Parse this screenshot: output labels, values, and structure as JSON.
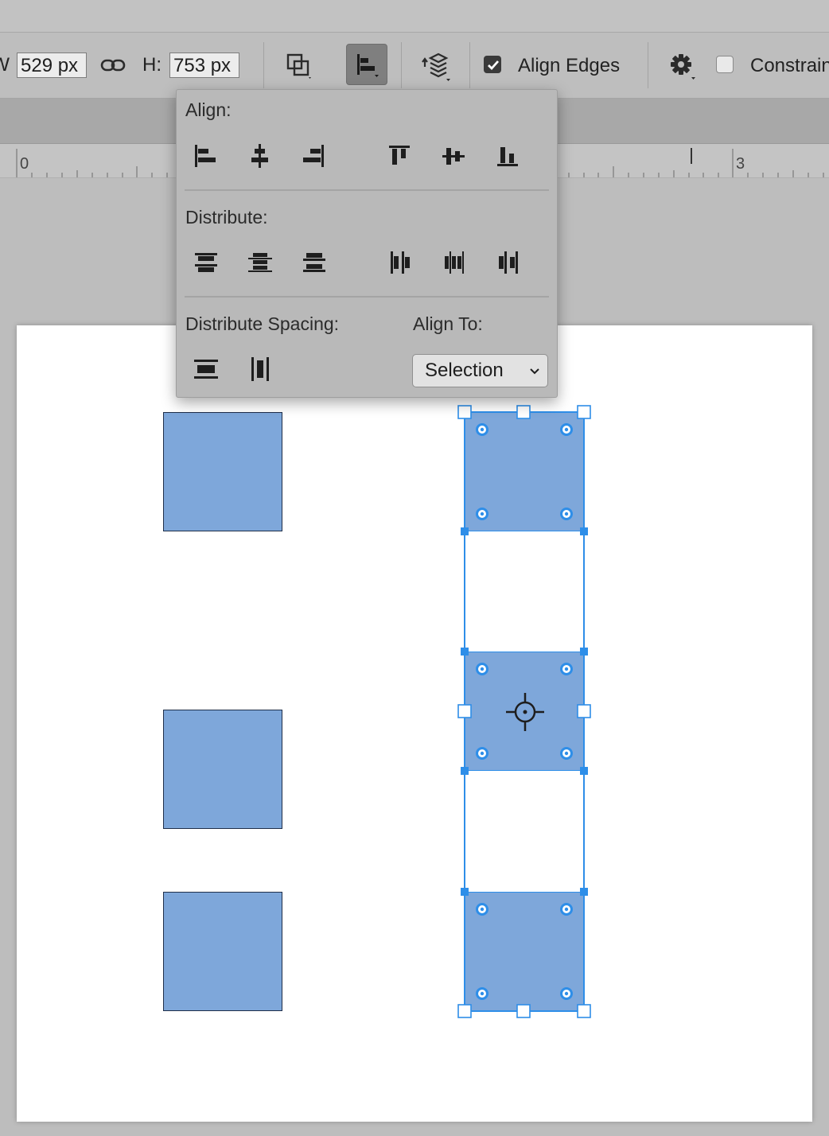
{
  "options_bar": {
    "width_label": "W:",
    "width_value": "529 px",
    "height_label": "H:",
    "height_value": "753 px",
    "align_edges_label": "Align Edges",
    "align_edges_checked": true,
    "constrain_label": "Constrain",
    "constrain_checked": false
  },
  "ruler": {
    "labels": [
      "0",
      "3"
    ]
  },
  "align_popup": {
    "align_title": "Align:",
    "distribute_title": "Distribute:",
    "distribute_spacing_title": "Distribute Spacing:",
    "align_to_title": "Align To:",
    "align_to_value": "Selection"
  },
  "colors": {
    "shape_fill": "#7ea7da",
    "selection_blue": "#2e8ee8",
    "panel_bg": "#bebebe"
  }
}
